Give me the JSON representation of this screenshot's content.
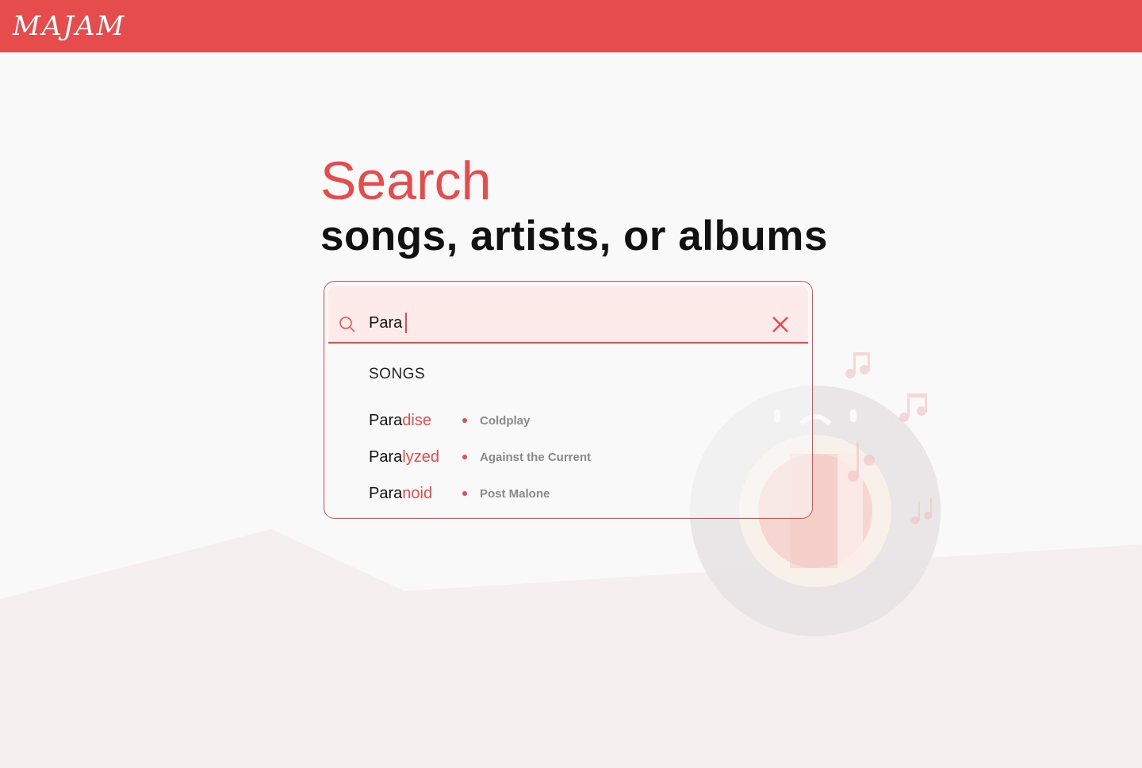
{
  "app": {
    "logo_text": "MAJAM"
  },
  "colors": {
    "accent": "#e64c4c",
    "topbar": "#e64c4c",
    "field_bg": "#fcebe8",
    "page_bg": "#f9f9f9"
  },
  "hero": {
    "title": "Search",
    "subtitle": "songs, artists, or albums"
  },
  "search": {
    "value": "Para",
    "icon": "search-icon",
    "clear_icon": "close-icon"
  },
  "results": {
    "section_label": "SONGS",
    "songs": [
      {
        "match": "Para",
        "rest": "dise",
        "artist": "Coldplay"
      },
      {
        "match": "Para",
        "rest": "lyzed",
        "artist": "Against the Current"
      },
      {
        "match": "Para",
        "rest": "noid",
        "artist": "Post Malone"
      }
    ]
  }
}
